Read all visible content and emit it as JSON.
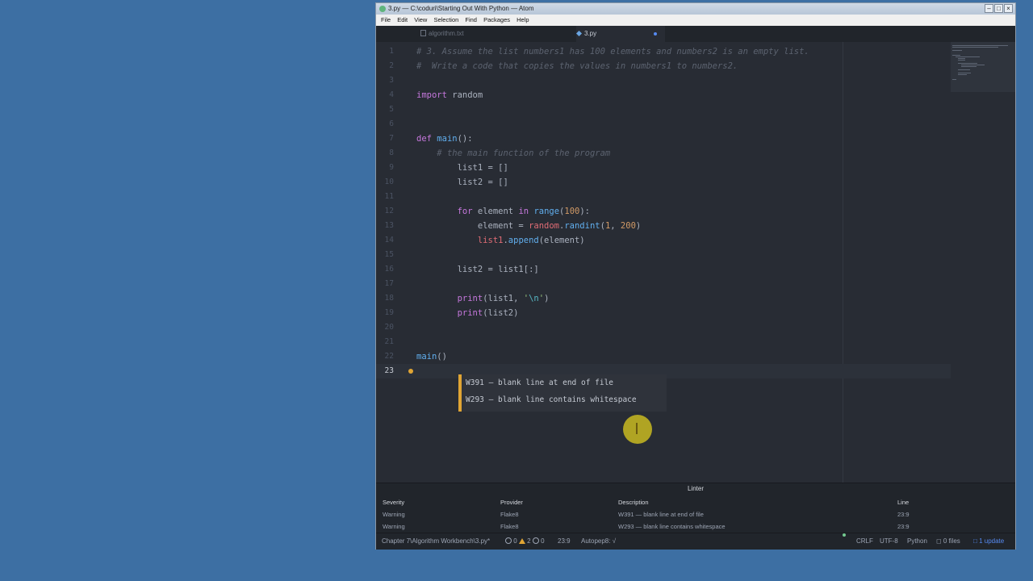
{
  "window": {
    "title": "3.py — C:\\coduri\\Starting Out With Python — Atom"
  },
  "menu": [
    "File",
    "Edit",
    "View",
    "Selection",
    "Find",
    "Packages",
    "Help"
  ],
  "tabs": [
    {
      "label": "algorithm.txt",
      "active": false
    },
    {
      "label": "3.py",
      "active": true,
      "modified": true
    }
  ],
  "editor": {
    "current_line": 23,
    "lines": [
      [
        [
          "c-com",
          "# 3. Assume the list numbers1 has 100 elements and numbers2 is an empty list."
        ]
      ],
      [
        [
          "c-com",
          "#  Write a code that copies the values in numbers1 to numbers2."
        ]
      ],
      [],
      [
        [
          "c-kw",
          "import"
        ],
        [
          "",
          " random"
        ]
      ],
      [],
      [],
      [
        [
          "c-kw",
          "def"
        ],
        [
          "",
          " "
        ],
        [
          "c-fn",
          "main"
        ],
        [
          "",
          "():"
        ]
      ],
      [
        [
          "",
          "    "
        ],
        [
          "c-com",
          "# the main function of the program"
        ]
      ],
      [
        [
          "",
          "        list1 = []"
        ]
      ],
      [
        [
          "",
          "        list2 = []"
        ]
      ],
      [],
      [
        [
          "",
          "        "
        ],
        [
          "c-kw",
          "for"
        ],
        [
          "",
          " element "
        ],
        [
          "c-kw",
          "in"
        ],
        [
          "",
          " "
        ],
        [
          "c-fn",
          "range"
        ],
        [
          "",
          "("
        ],
        [
          "c-num",
          "100"
        ],
        [
          "",
          "):"
        ]
      ],
      [
        [
          "",
          "            element = "
        ],
        [
          "c-var",
          "random"
        ],
        [
          "",
          "."
        ],
        [
          "c-fn",
          "randint"
        ],
        [
          "",
          "("
        ],
        [
          "c-num",
          "1"
        ],
        [
          "",
          ", "
        ],
        [
          "c-num",
          "200"
        ],
        [
          "",
          ")"
        ]
      ],
      [
        [
          "",
          "            "
        ],
        [
          "c-var",
          "list1"
        ],
        [
          "",
          "."
        ],
        [
          "c-fn",
          "append"
        ],
        [
          "",
          "(element)"
        ]
      ],
      [],
      [
        [
          "",
          "        list2 = list1[:]"
        ]
      ],
      [],
      [
        [
          "",
          "        "
        ],
        [
          "c-kw",
          "print"
        ],
        [
          "",
          "(list1, "
        ],
        [
          "c-str",
          "'"
        ],
        [
          "c-esc",
          "\\n"
        ],
        [
          "c-str",
          "'"
        ],
        [
          "",
          ")"
        ]
      ],
      [
        [
          "",
          "        "
        ],
        [
          "c-kw",
          "print"
        ],
        [
          "",
          "(list2)"
        ]
      ],
      [],
      [],
      [
        [
          "c-fn",
          "main"
        ],
        [
          "",
          "()"
        ]
      ],
      [
        [
          "",
          "    "
        ]
      ]
    ]
  },
  "lint_tooltip": [
    "W391 — blank line at end of file",
    "W293 — blank line contains whitespace"
  ],
  "linter_panel": {
    "title": "Linter",
    "headers": {
      "severity": "Severity",
      "provider": "Provider",
      "description": "Description",
      "line": "Line"
    },
    "rows": [
      {
        "severity": "Warning",
        "provider": "Flake8",
        "description": "W391 — blank line at end of file",
        "line": "23:9"
      },
      {
        "severity": "Warning",
        "provider": "Flake8",
        "description": "W293 — blank line contains whitespace",
        "line": "23:9"
      }
    ]
  },
  "statusbar": {
    "path": "Chapter 7\\Algorithm Workbench\\3.py*",
    "errors": "0",
    "warnings": "2",
    "infos": "0",
    "cursor": "23:9",
    "autopep": "Autopep8: √",
    "line_ending": "CRLF",
    "encoding": "UTF-8",
    "grammar": "Python",
    "files": "0 files",
    "update": "1 update"
  }
}
